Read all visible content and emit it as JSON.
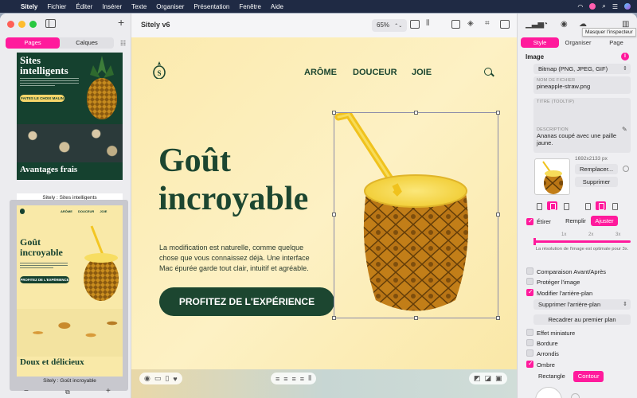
{
  "menubar": {
    "app": "Sitely",
    "items": [
      "Fichier",
      "Éditer",
      "Insérer",
      "Texte",
      "Organiser",
      "Présentation",
      "Fenêtre",
      "Aide"
    ]
  },
  "left_panel": {
    "tabs": [
      "Pages",
      "Calques"
    ],
    "active_tab": "Pages",
    "pages": [
      {
        "caption": "Sitely : Sites intelligents",
        "title": "Sites intelligents",
        "button": "FAITES LE CHOIX MALIN",
        "subtitle": "Avantages frais"
      },
      {
        "caption": "Sitely : Goût incroyable",
        "nav": "ARÔME DOUCEUR JOIE",
        "title": "Goût incroyable",
        "button": "PROFITEZ DE L'EXPÉRIENCE",
        "subtitle": "Doux et délicieux"
      }
    ],
    "bottom": {
      "minus": "−",
      "plus": "+"
    }
  },
  "toolbar": {
    "doc_title": "Sitely v6",
    "zoom": "65%",
    "zoom_arrows": "⌃⌄",
    "add": "+"
  },
  "canvas": {
    "nav": [
      "ARÔME",
      "DOUCEUR",
      "JOIE"
    ],
    "hero_title_line1": "Goût",
    "hero_title_line2": "incroyable",
    "hero_text": "La modification est naturelle, comme quelque chose que vous connaissez déjà. Une interface Mac épurée garde tout clair, intuitif et agréable.",
    "hero_button": "PROFITEZ DE L'EXPÉRIENCE"
  },
  "inspector": {
    "tabs": [
      "Style",
      "Organiser",
      "Page"
    ],
    "active_tab": "Style",
    "tooltip": "Masquer l'inspecteur",
    "section": "Image",
    "info": "i",
    "format": "Bitmap (PNG, JPEG, GIF)",
    "filename_label": "NOM DE FICHIER",
    "filename": "pineapple-straw.png",
    "tooltip_label": "TITRE (TOOLTIP)",
    "tooltip_value": "",
    "description_label": "DESCRIPTION",
    "description": "Ananas coupé avec une paille jaune.",
    "dimensions": "1692x2133 px",
    "replace": "Remplacer...",
    "delete": "Supprimer",
    "fit_modes": [
      "Étirer",
      "Remplir",
      "Ajuster"
    ],
    "fit_active": "Ajuster",
    "scale_ticks": [
      "1x",
      "2x",
      "3x"
    ],
    "resolution_note": "La résolution de l'image est optimale pour 3x.",
    "options": [
      {
        "label": "Comparaison Avant/Après",
        "checked": false
      },
      {
        "label": "Protéger l'image",
        "checked": false
      },
      {
        "label": "Modifier l'arrière-plan",
        "checked": true
      }
    ],
    "background_action": "Supprimer l'arrière-plan",
    "recrop": "Recadrer au premier plan",
    "options2": [
      {
        "label": "Effet miniature",
        "checked": false
      },
      {
        "label": "Bordure",
        "checked": false
      },
      {
        "label": "Arrondis",
        "checked": false
      },
      {
        "label": "Ombre",
        "checked": true
      }
    ],
    "shadow_modes": [
      "Rectangle",
      "Contour"
    ],
    "shadow_active": "Contour"
  },
  "colors": {
    "accent": "#ff1a9c",
    "brand_green": "#1c4630",
    "canvas_bg": "#fbeaae"
  }
}
